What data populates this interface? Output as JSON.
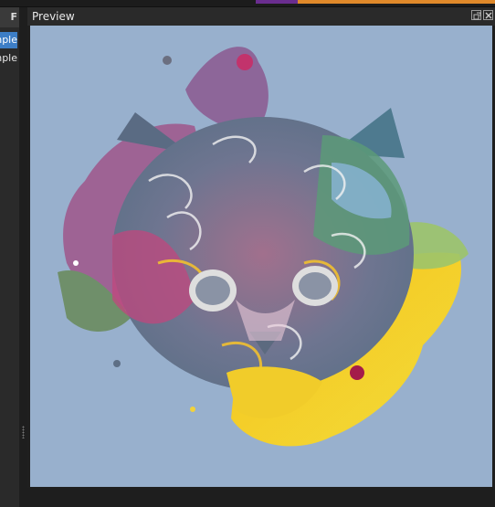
{
  "left_panel": {
    "header_label": "F",
    "rows": [
      "Simple",
      "Simple"
    ]
  },
  "preview": {
    "title": "Preview",
    "icons": {
      "float": "float-window-icon",
      "close": "close-icon"
    },
    "artwork": "colorful painted kitten face",
    "background_color": "#98b0cd"
  },
  "colors": {
    "accent_orange": "#e0892a",
    "accent_purple": "#6a2d8f",
    "selection_blue": "#3d7ec6"
  }
}
